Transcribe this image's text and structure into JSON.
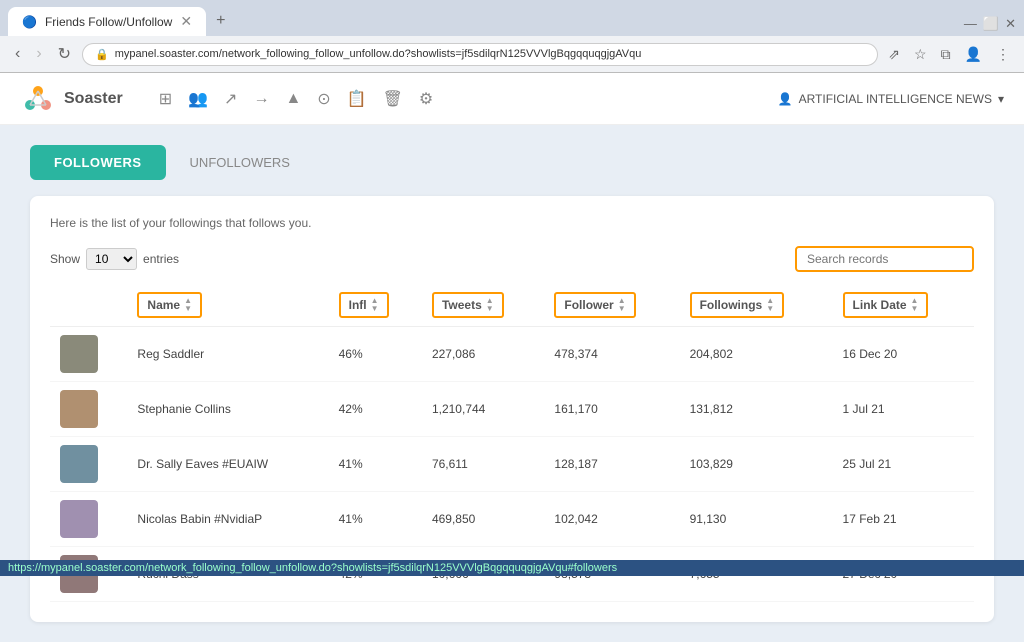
{
  "browser": {
    "tab_title": "Friends Follow/Unfollow",
    "url": "mypanel.soaster.com/network_following_follow_unfollow.do?showlists=jf5sdilqrN125VVVlgBqgqquqgjgAVqu",
    "status_url": "https://mypanel.soaster.com/network_following_follow_unfollow.do?showlists=jf5sdilqrN125VVVlgBqgqquqgjgAVqu#followers"
  },
  "topbar": {
    "logo_text": "Soaster",
    "user_menu_label": "ARTIFICIAL INTELLIGENCE NEWS",
    "user_menu_arrow": "▾"
  },
  "tabs": {
    "followers_label": "FOLLOWERS",
    "unfollowers_label": "UNFOLLOWERS"
  },
  "card": {
    "description": "Here is the list of your followings that follows you."
  },
  "table_controls": {
    "show_label": "Show",
    "entries_value": "10",
    "entries_label": "entries",
    "search_placeholder": "Search records"
  },
  "columns": [
    {
      "id": "avatar",
      "label": ""
    },
    {
      "id": "name",
      "label": "Name",
      "sortable": true
    },
    {
      "id": "infl",
      "label": "Infl",
      "sortable": true
    },
    {
      "id": "tweets",
      "label": "Tweets",
      "sortable": true
    },
    {
      "id": "follower",
      "label": "Follower",
      "sortable": true
    },
    {
      "id": "followings",
      "label": "Followings",
      "sortable": true
    },
    {
      "id": "link_date",
      "label": "Link Date",
      "sortable": true
    }
  ],
  "rows": [
    {
      "avatar_bg": "#8a7",
      "name": "Reg Saddler",
      "infl": "46%",
      "tweets": "227,086",
      "follower": "478,374",
      "followings": "204,802",
      "link_date": "16 Dec 20"
    },
    {
      "avatar_bg": "#a98",
      "name": "Stephanie Collins",
      "infl": "42%",
      "tweets": "1,210,744",
      "follower": "161,170",
      "followings": "131,812",
      "link_date": "1 Jul 21"
    },
    {
      "avatar_bg": "#789",
      "name": "Dr. Sally Eaves #EUAIW",
      "infl": "41%",
      "tweets": "76,611",
      "follower": "128,187",
      "followings": "103,829",
      "link_date": "25 Jul 21"
    },
    {
      "avatar_bg": "#98a",
      "name": "Nicolas Babin #NvidiaP",
      "infl": "41%",
      "tweets": "469,850",
      "follower": "102,042",
      "followings": "91,130",
      "link_date": "17 Feb 21"
    },
    {
      "avatar_bg": "#876",
      "name": "Ruchi Dass",
      "infl": "42%",
      "tweets": "10,666",
      "follower": "98,573",
      "followings": "7,655",
      "link_date": "27 Dec 20"
    }
  ],
  "colors": {
    "accent": "#2ab5a0",
    "border_highlight": "#f90",
    "link": "#2c5282"
  },
  "nav_icons": [
    "⊞",
    "👤",
    "↗",
    "→",
    "▲",
    "⊙",
    "📋",
    "🗑",
    "⚙"
  ]
}
